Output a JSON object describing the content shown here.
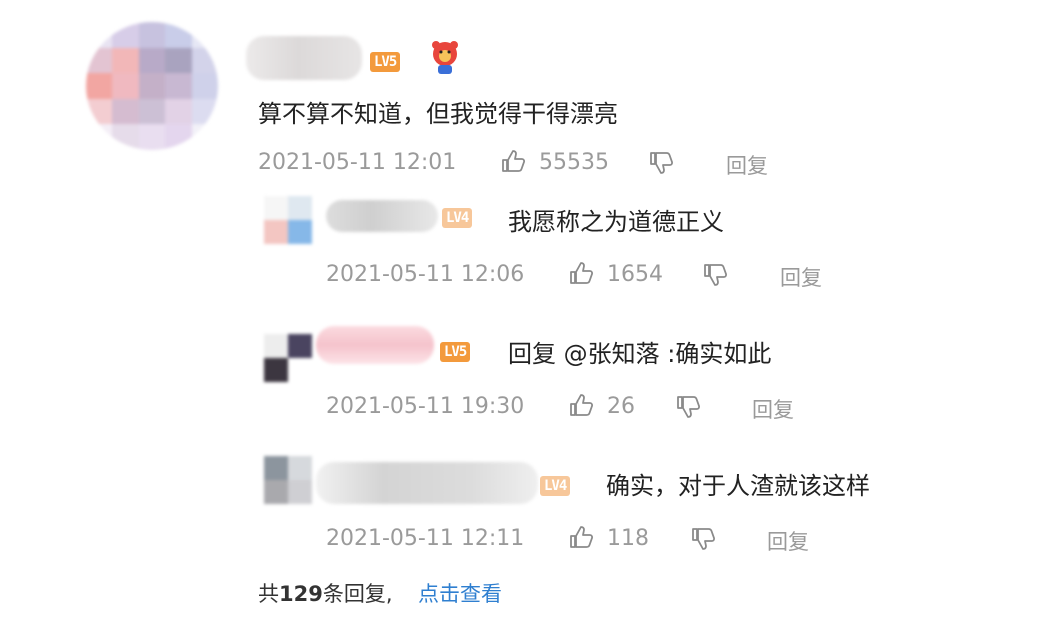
{
  "main_comment": {
    "level_badge": "LV5",
    "text": "算不算不知道，但我觉得干得漂亮",
    "time": "2021-05-11 12:01",
    "likes": "55535",
    "reply_label": "回复",
    "colors": {
      "badge": "#f39a3c"
    }
  },
  "replies": [
    {
      "level_badge": "LV4",
      "text": "我愿称之为道德正义",
      "time": "2021-05-11 12:06",
      "likes": "1654",
      "reply_label": "回复"
    },
    {
      "level_badge": "LV5",
      "text": "回复 @张知落 :确实如此",
      "time": "2021-05-11 19:30",
      "likes": "26",
      "reply_label": "回复"
    },
    {
      "level_badge": "LV4",
      "text": "确实，对于人渣就该这样",
      "time": "2021-05-11 12:11",
      "likes": "118",
      "reply_label": "回复"
    }
  ],
  "footer": {
    "prefix": "共",
    "count": "129",
    "suffix": "条回复,",
    "view_link": "点击查看"
  },
  "icons": [
    "thumbs-up-icon",
    "thumbs-down-icon",
    "bear-badge-icon"
  ]
}
